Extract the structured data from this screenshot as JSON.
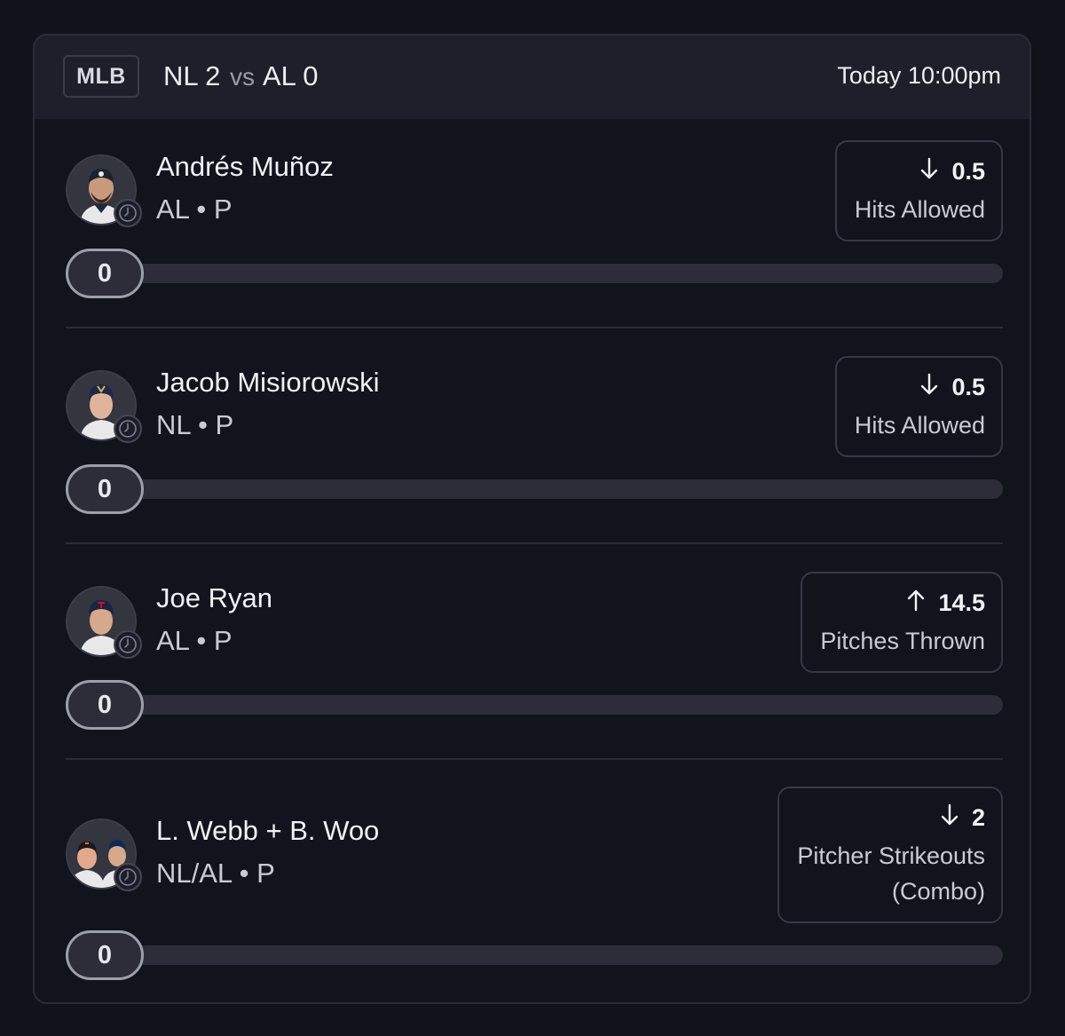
{
  "header": {
    "league": "MLB",
    "home_team": "NL",
    "home_score": "2",
    "vs": "vs",
    "away_team": "AL",
    "away_score": "0",
    "time": "Today 10:00pm"
  },
  "players": [
    {
      "name": "Andrés Muñoz",
      "meta": "AL • P",
      "direction": "down",
      "line": "0.5",
      "stat": "Hits Allowed",
      "stat2": "",
      "current": "0",
      "progress_fraction": 0,
      "avatar_icon": "player-headshot-icon"
    },
    {
      "name": "Jacob Misiorowski",
      "meta": "NL • P",
      "direction": "down",
      "line": "0.5",
      "stat": "Hits Allowed",
      "stat2": "",
      "current": "0",
      "progress_fraction": 0,
      "avatar_icon": "player-headshot-icon"
    },
    {
      "name": "Joe Ryan",
      "meta": "AL • P",
      "direction": "up",
      "line": "14.5",
      "stat": "Pitches Thrown",
      "stat2": "",
      "current": "0",
      "progress_fraction": 0,
      "avatar_icon": "player-headshot-icon"
    },
    {
      "name": "L. Webb + B. Woo",
      "meta": "NL/AL • P",
      "direction": "down",
      "line": "2",
      "stat": "Pitcher Strikeouts",
      "stat2": "(Combo)",
      "current": "0",
      "progress_fraction": 0,
      "avatar_icon": "combo-headshot-icon"
    }
  ],
  "colors": {
    "background": "#10121c",
    "card": "#11131d",
    "header": "#1d1f2a",
    "track": "#2c2d38"
  }
}
